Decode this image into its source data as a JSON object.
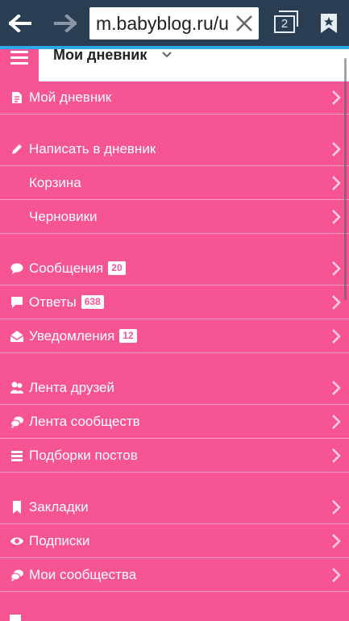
{
  "browser": {
    "url": "m.babyblog.ru/u",
    "tab_count": "2"
  },
  "header": {
    "title": "Мои дневник"
  },
  "menu": {
    "items": [
      {
        "label": "Мой дневник",
        "icon": "document-icon",
        "badge": ""
      },
      {
        "label": "Написать в дневник",
        "icon": "pencil-icon",
        "badge": ""
      },
      {
        "label": "Корзина",
        "icon": "",
        "badge": ""
      },
      {
        "label": "Черновики",
        "icon": "",
        "badge": ""
      },
      {
        "label": "Сообщения",
        "icon": "speech-bubble-icon",
        "badge": "20"
      },
      {
        "label": "Ответы",
        "icon": "reply-bubble-icon",
        "badge": "638"
      },
      {
        "label": "Уведомления",
        "icon": "envelope-open-icon",
        "badge": "12"
      },
      {
        "label": "Лента друзей",
        "icon": "friends-icon",
        "badge": ""
      },
      {
        "label": "Лента сообществ",
        "icon": "communities-icon",
        "badge": ""
      },
      {
        "label": "Подборки постов",
        "icon": "stack-icon",
        "badge": ""
      },
      {
        "label": "Закладки",
        "icon": "bookmark-icon",
        "badge": ""
      },
      {
        "label": "Подписки",
        "icon": "eye-icon",
        "badge": ""
      },
      {
        "label": "Мои сообщества",
        "icon": "communities-icon",
        "badge": ""
      }
    ]
  },
  "colors": {
    "menu_bg": "#f75493",
    "browser_bar": "#2a3f53",
    "progress": "#2ea8e6"
  }
}
